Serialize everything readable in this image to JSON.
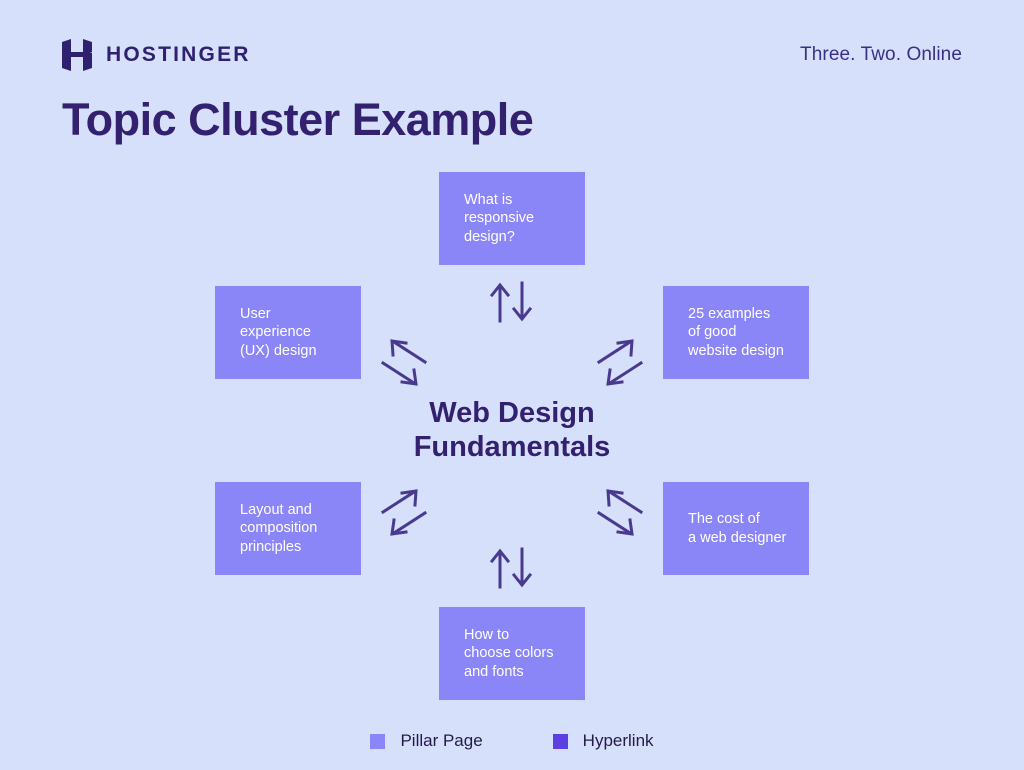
{
  "header": {
    "brand_name": "HOSTINGER",
    "logo_icon": "hostinger-h-logo",
    "tagline": "Three. Two. Online"
  },
  "title": "Topic Cluster Example",
  "colors": {
    "background": "#d6e0fb",
    "cluster_node": "#8b86f7",
    "pillar_text": "#33206e",
    "arrow": "#4a3a8f",
    "legend_pillar_swatch": "#8b86f7",
    "legend_hyperlink_swatch": "#5b3fe0",
    "brand": "#2f2070"
  },
  "diagram": {
    "type": "topic-cluster",
    "pillar": {
      "label": "Web Design\nFundamentals",
      "role": "Pillar Page"
    },
    "clusters": [
      {
        "position": "top",
        "label": "What is\nresponsive\ndesign?"
      },
      {
        "position": "left-upper",
        "label": "User\nexperience\n(UX) design"
      },
      {
        "position": "right-upper",
        "label": "25 examples\nof good\nwebsite design"
      },
      {
        "position": "left-lower",
        "label": "Layout and\ncomposition\nprinciples"
      },
      {
        "position": "right-lower",
        "label": "The cost of\na web designer"
      },
      {
        "position": "bottom",
        "label": "How to\nchoose colors\nand fonts"
      }
    ],
    "connectors": [
      {
        "name": "top-connector",
        "icon": "up-down-arrows-icon"
      },
      {
        "name": "upper-left-connector",
        "icon": "diagonal-upleft-downright-arrows-icon"
      },
      {
        "name": "upper-right-connector",
        "icon": "diagonal-upright-downleft-arrows-icon"
      },
      {
        "name": "lower-left-connector",
        "icon": "diagonal-upright-downleft-arrows-icon"
      },
      {
        "name": "lower-right-connector",
        "icon": "diagonal-upleft-downright-arrows-icon"
      },
      {
        "name": "bottom-connector",
        "icon": "up-down-arrows-icon"
      }
    ]
  },
  "legend": {
    "items": [
      {
        "label": "Pillar Page",
        "swatch_color": "#8b86f7"
      },
      {
        "label": "Hyperlink",
        "swatch_color": "#5b3fe0"
      }
    ]
  }
}
